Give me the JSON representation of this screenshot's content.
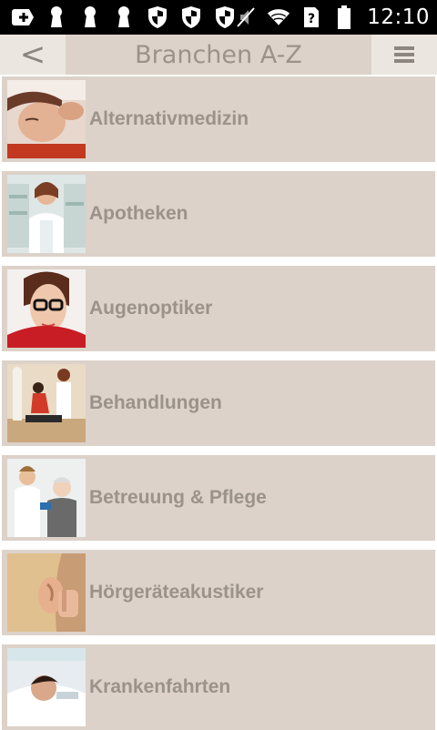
{
  "status_bar": {
    "time": "12:10",
    "icons": [
      "plus-box-icon",
      "keyhole-icon",
      "keyhole-icon",
      "keyhole-icon",
      "shield-icon",
      "shield-icon",
      "shield-icon",
      "muted-icon",
      "wifi-icon",
      "question-sim-icon",
      "battery-icon"
    ]
  },
  "header": {
    "back_label": "<",
    "title": "Branchen A-Z",
    "menu_icon": "hamburger-icon"
  },
  "categories": [
    {
      "label": "Alternativmedizin"
    },
    {
      "label": "Apotheken"
    },
    {
      "label": "Augenoptiker"
    },
    {
      "label": "Behandlungen"
    },
    {
      "label": "Betreuung & Pflege"
    },
    {
      "label": "Hörgeräteakustiker"
    },
    {
      "label": "Krankenfahrten"
    }
  ],
  "colors": {
    "item_background": "#dcd2c9",
    "text": "#9a928b",
    "header_button_background": "#ece6e0"
  }
}
